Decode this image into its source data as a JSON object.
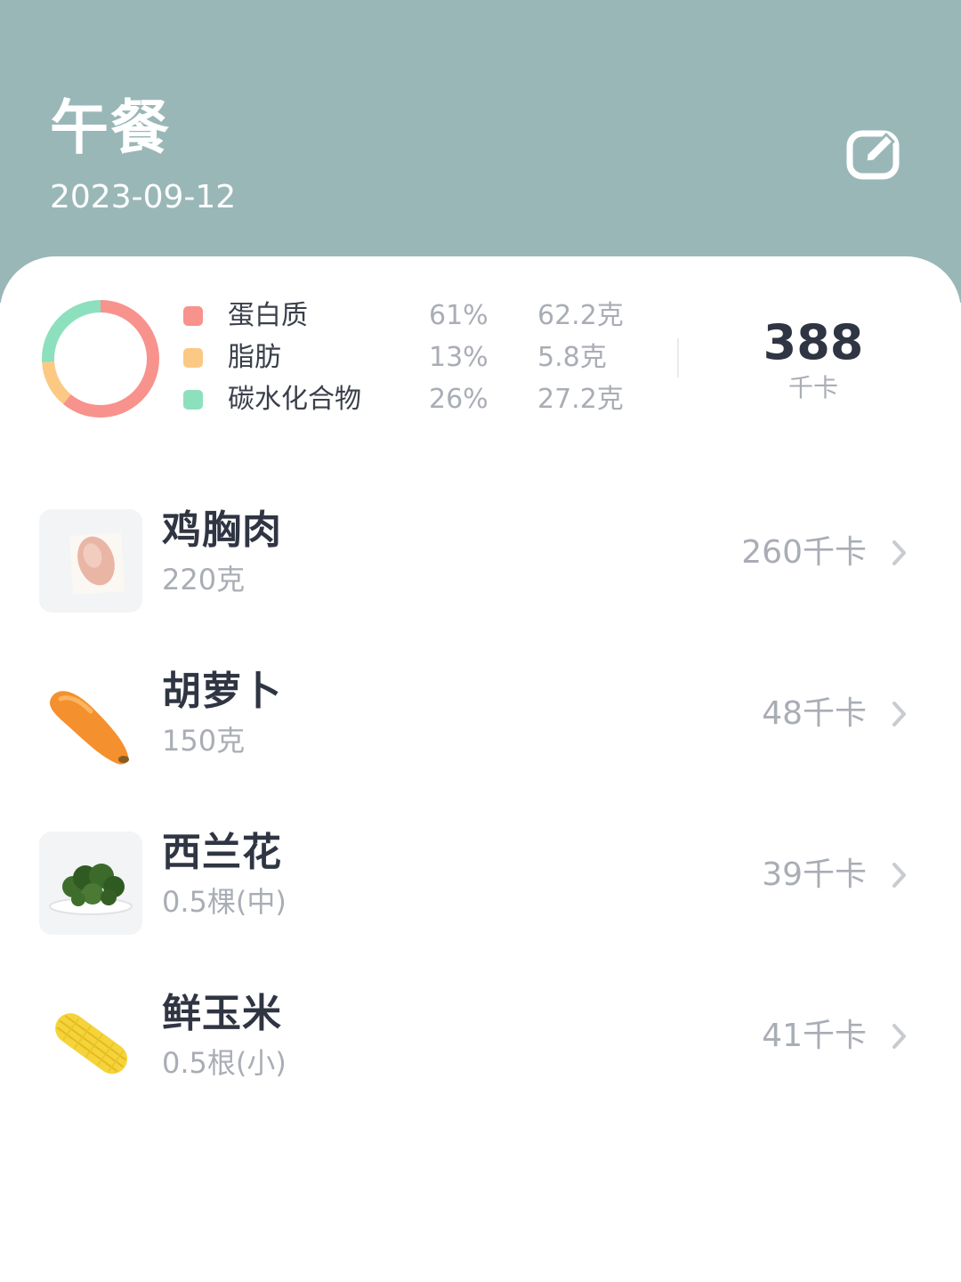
{
  "header": {
    "title": "午餐",
    "date": "2023-09-12",
    "background_color": "#9ab7b8",
    "edit_icon": "edit-icon"
  },
  "summary": {
    "macros": [
      {
        "name": "蛋白质",
        "percent": "61%",
        "amount": "62.2克",
        "color": "#f8928c",
        "share": 0.61
      },
      {
        "name": "脂肪",
        "percent": "13%",
        "amount": "5.8克",
        "color": "#fbc983",
        "share": 0.13
      },
      {
        "name": "碳水化合物",
        "percent": "26%",
        "amount": "27.2克",
        "color": "#8de0bd",
        "share": 0.26
      }
    ],
    "total_kcal": "388",
    "total_unit": "千卡"
  },
  "foods": [
    {
      "name": "鸡胸肉",
      "quantity": "220克",
      "kcal": "260千卡",
      "icon": "chicken-breast-image"
    },
    {
      "name": "胡萝卜",
      "quantity": "150克",
      "kcal": "48千卡",
      "icon": "carrot-image"
    },
    {
      "name": "西兰花",
      "quantity": "0.5棵(中)",
      "kcal": "39千卡",
      "icon": "broccoli-image"
    },
    {
      "name": "鲜玉米",
      "quantity": "0.5根(小)",
      "kcal": "41千卡",
      "icon": "corn-image"
    }
  ]
}
